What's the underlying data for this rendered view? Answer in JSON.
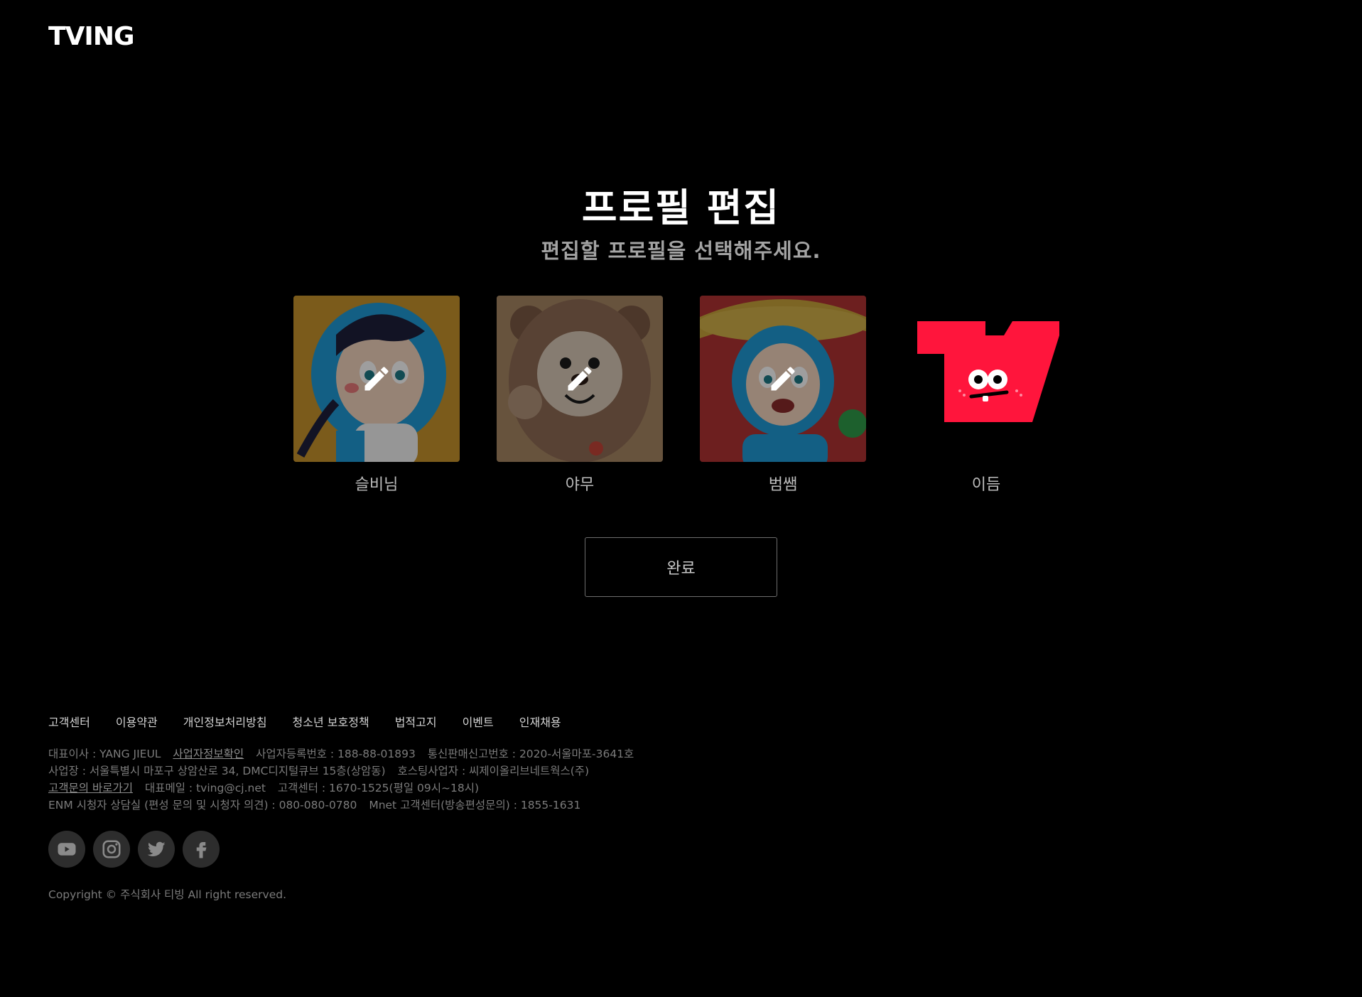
{
  "header": {
    "logo_text": "TVING"
  },
  "page": {
    "title": "프로필 편집",
    "subtitle": "편집할 프로필을 선택해주세요."
  },
  "profiles": [
    {
      "name": "슬비님",
      "avatar": "blue-hooded-girl-character"
    },
    {
      "name": "야무",
      "avatar": "brown-teddy-bear"
    },
    {
      "name": "범쌤",
      "avatar": "boy-with-straw-hat"
    },
    {
      "name": "이듬",
      "avatar": "red-tving-mascot"
    }
  ],
  "actions": {
    "done_label": "완료"
  },
  "footer": {
    "links": [
      "고객센터",
      "이용약관",
      "개인정보처리방침",
      "청소년 보호정책",
      "법적고지",
      "이벤트",
      "인재채용"
    ],
    "info": {
      "ceo": "대표이사 : YANG JIEUL",
      "biz_check": "사업자정보확인",
      "biz_reg": "사업자등록번호 : 188-88-01893",
      "mail_order": "통신판매신고번호 : 2020-서울마포-3641호",
      "address": "사업장 : 서울특별시 마포구 상암산로 34, DMC디지털큐브 15층(상암동)",
      "hosting": "호스팅사업자 : 씨제이올리브네트웍스(주)",
      "contact_link": "고객문의 바로가기",
      "email": "대표메일 : tving@cj.net",
      "cs_center": "고객센터 : 1670-1525(평일 09시~18시)",
      "enm": "ENM 시청자 상담실 (편성 문의 및 시청자 의견) : 080-080-0780",
      "mnet": "Mnet 고객센터(방송편성문의) : 1855-1631"
    },
    "social": [
      "youtube-icon",
      "instagram-icon",
      "twitter-icon",
      "facebook-icon"
    ],
    "copyright": "Copyright © 주식회사 티빙 All right reserved."
  },
  "colors": {
    "background": "#000000",
    "brand_red": "#ff153c"
  }
}
